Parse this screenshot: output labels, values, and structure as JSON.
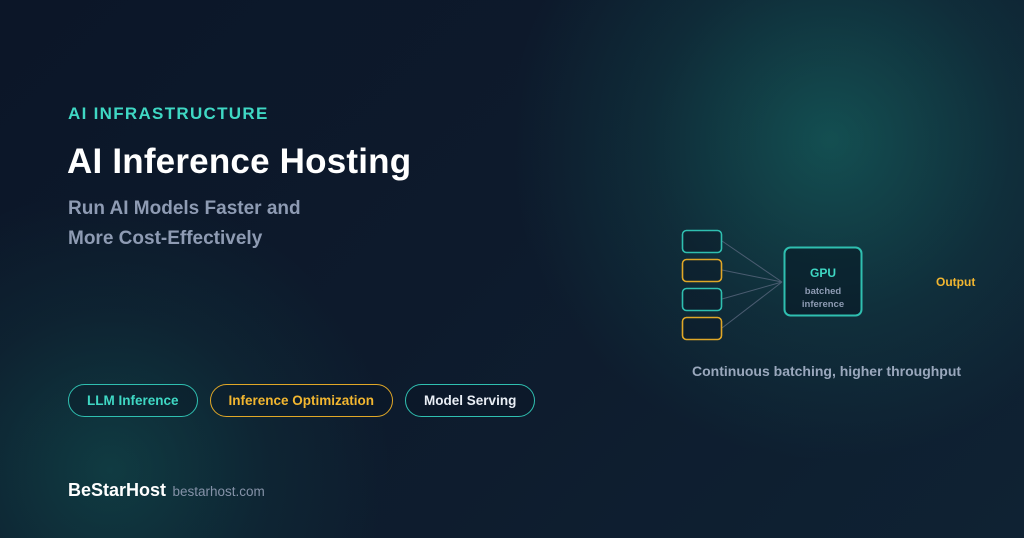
{
  "hero": {
    "eyebrow": "AI INFRASTRUCTURE",
    "title": "AI Inference Hosting",
    "subtitle_line1": "Run AI Models Faster and",
    "subtitle_line2": "More Cost-Effectively"
  },
  "tags": [
    {
      "label": "LLM Inference",
      "color": "#3fd8c4"
    },
    {
      "label": "Inference Optimization",
      "color": "#f2b630"
    },
    {
      "label": "Model Serving",
      "color": "#e9eef5"
    }
  ],
  "diagram": {
    "gpu_label": "GPU",
    "gpu_sub_line1": "batched",
    "gpu_sub_line2": "inference",
    "output_label": "Output",
    "caption": "Continuous batching, higher throughput",
    "request_colors": [
      "#2fbfb0",
      "#e0a727",
      "#2fbfb0",
      "#e0a727"
    ]
  },
  "brand": {
    "name": "BeStarHost",
    "url": "bestarhost.com"
  },
  "colors": {
    "accent_teal": "#3fd8c4",
    "accent_amber": "#f2b630",
    "background": "#0d1a2c"
  }
}
